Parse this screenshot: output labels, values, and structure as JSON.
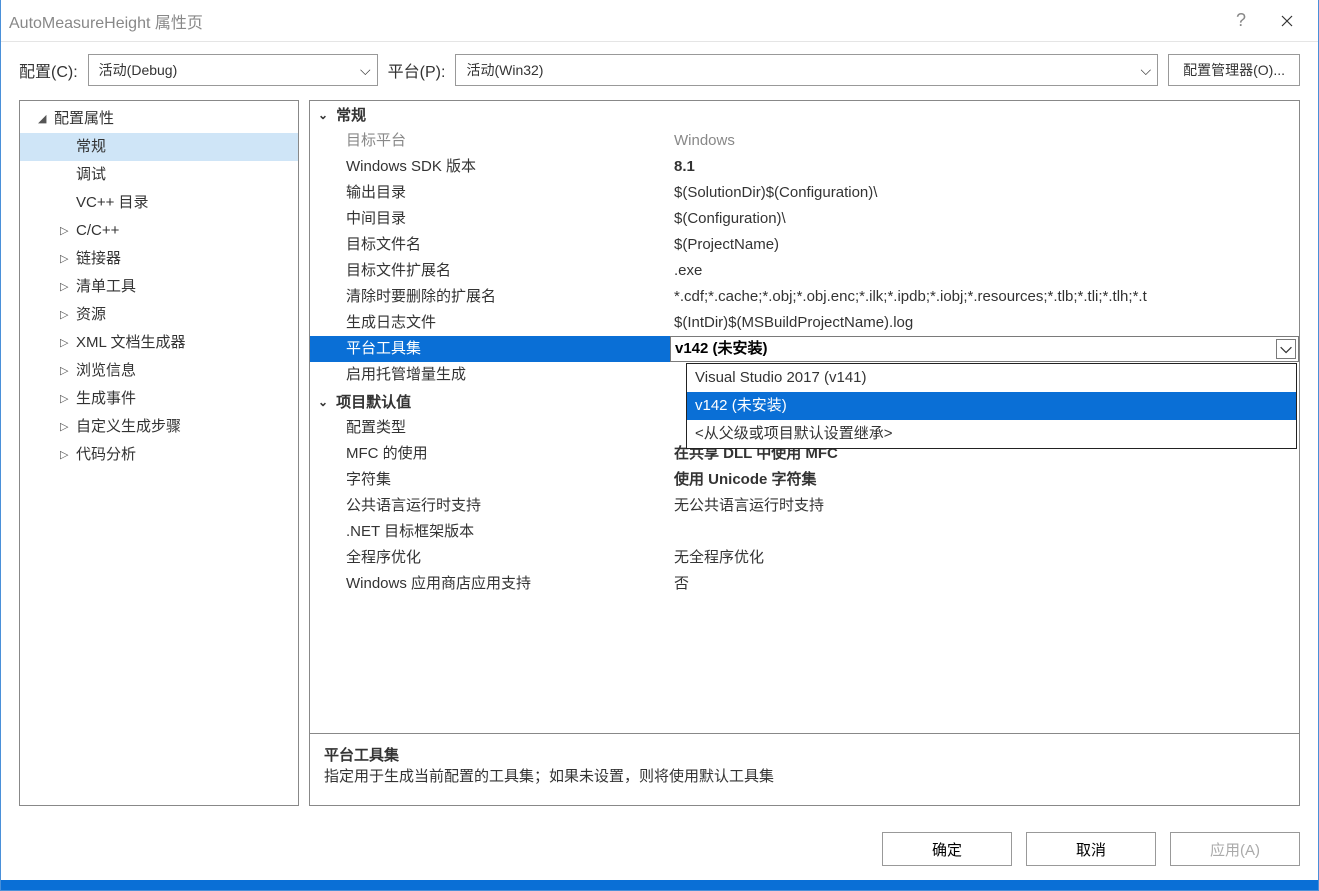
{
  "title": "AutoMeasureHeight 属性页",
  "toolbar": {
    "config_label": "配置(C):",
    "config_value": "活动(Debug)",
    "platform_label": "平台(P):",
    "platform_value": "活动(Win32)",
    "config_manager": "配置管理器(O)..."
  },
  "tree": {
    "root": "配置属性",
    "items": [
      "常规",
      "调试",
      "VC++ 目录",
      "C/C++",
      "链接器",
      "清单工具",
      "资源",
      "XML 文档生成器",
      "浏览信息",
      "生成事件",
      "自定义生成步骤",
      "代码分析"
    ],
    "childStart": 3,
    "selectedIndex": 0
  },
  "sections": [
    {
      "title": "常规",
      "rows": [
        {
          "k": "目标平台",
          "v": "Windows",
          "grey": true
        },
        {
          "k": "Windows SDK 版本",
          "v": "8.1",
          "bold": true
        },
        {
          "k": "输出目录",
          "v": "$(SolutionDir)$(Configuration)\\"
        },
        {
          "k": "中间目录",
          "v": "$(Configuration)\\"
        },
        {
          "k": "目标文件名",
          "v": "$(ProjectName)"
        },
        {
          "k": "目标文件扩展名",
          "v": ".exe"
        },
        {
          "k": "清除时要删除的扩展名",
          "v": "*.cdf;*.cache;*.obj;*.obj.enc;*.ilk;*.ipdb;*.iobj;*.resources;*.tlb;*.tli;*.tlh;*.t"
        },
        {
          "k": "生成日志文件",
          "v": "$(IntDir)$(MSBuildProjectName).log"
        },
        {
          "k": "平台工具集",
          "v": "v142 (未安装)",
          "bold": true,
          "selected": true
        },
        {
          "k": "启用托管增量生成",
          "v": ""
        }
      ]
    },
    {
      "title": "项目默认值",
      "rows": [
        {
          "k": "配置类型",
          "v": ""
        },
        {
          "k": "MFC 的使用",
          "v": "在共享 DLL 中使用 MFC",
          "bold": true
        },
        {
          "k": "字符集",
          "v": "使用 Unicode 字符集",
          "bold": true
        },
        {
          "k": "公共语言运行时支持",
          "v": "无公共语言运行时支持"
        },
        {
          "k": ".NET 目标框架版本",
          "v": ""
        },
        {
          "k": "全程序优化",
          "v": "无全程序优化"
        },
        {
          "k": "Windows 应用商店应用支持",
          "v": "否"
        }
      ]
    }
  ],
  "dropdown": {
    "options": [
      "Visual Studio 2017 (v141)",
      "v142 (未安装)",
      "<从父级或项目默认设置继承>"
    ],
    "selected": 1
  },
  "helpPane": {
    "title": "平台工具集",
    "desc": "指定用于生成当前配置的工具集；如果未设置，则将使用默认工具集"
  },
  "footer": {
    "ok": "确定",
    "cancel": "取消",
    "apply": "应用(A)"
  }
}
